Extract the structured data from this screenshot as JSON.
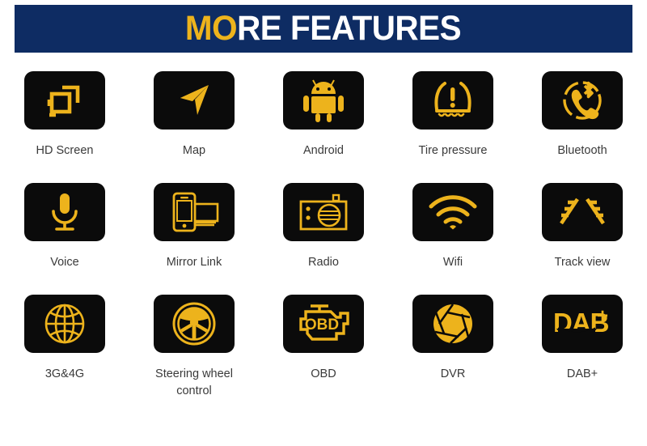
{
  "header": {
    "title_gold": "MO",
    "title_white": "RE FEATURES",
    "full_title": "MORE FEATURES",
    "background_color": "#0e2c63",
    "gold_color": "#edb31c",
    "white_color": "#ffffff"
  },
  "theme": {
    "tile_background": "#0b0b0b",
    "icon_color": "#edb31c",
    "label_color": "#3a3a3a",
    "page_background": "#ffffff"
  },
  "features": [
    {
      "label": "HD Screen",
      "icon": "hd-screen-icon"
    },
    {
      "label": "Map",
      "icon": "navigation-arrow-icon"
    },
    {
      "label": "Android",
      "icon": "android-robot-icon"
    },
    {
      "label": "Tire pressure",
      "icon": "tire-pressure-warning-icon"
    },
    {
      "label": "Bluetooth",
      "icon": "bluetooth-phone-icon"
    },
    {
      "label": "Voice",
      "icon": "microphone-icon"
    },
    {
      "label": "Mirror Link",
      "icon": "mirror-link-icon"
    },
    {
      "label": "Radio",
      "icon": "radio-icon"
    },
    {
      "label": "Wifi",
      "icon": "wifi-icon"
    },
    {
      "label": "Track view",
      "icon": "track-view-icon"
    },
    {
      "label": "3G&4G",
      "icon": "globe-icon"
    },
    {
      "label": "Steering wheel control",
      "icon": "steering-wheel-icon"
    },
    {
      "label": "OBD",
      "icon": "obd-engine-icon"
    },
    {
      "label": "DVR",
      "icon": "camera-aperture-icon"
    },
    {
      "label": "DAB+",
      "icon": "dab-plus-icon"
    }
  ],
  "icon_text": {
    "obd": "OBD",
    "dab": "DAB",
    "dab_plus": "+"
  }
}
